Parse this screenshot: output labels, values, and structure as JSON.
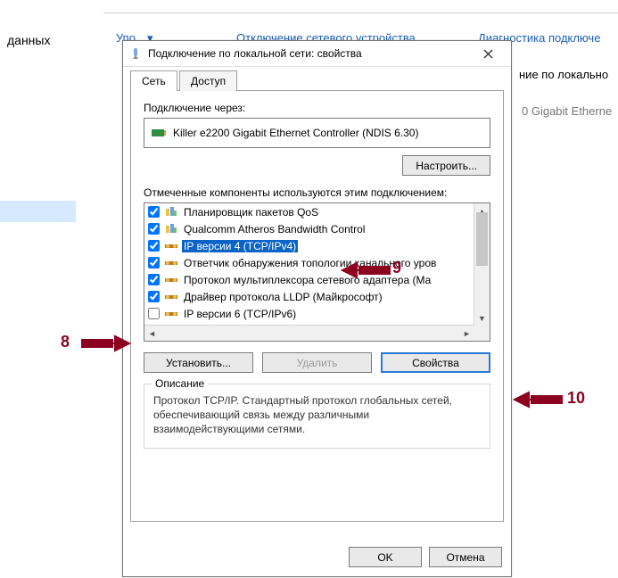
{
  "bg": {
    "left_text": "данных",
    "toolbar_fragment_1": "Упо…▾",
    "toolbar_fragment_2": "Отключение сетевого устройства",
    "toolbar_fragment_3": "Диагностика подключе",
    "side_text_1": "ние по локально",
    "side_text_2": "0 Gigabit Etherne"
  },
  "dialog": {
    "title": "Подключение по локальной сети: свойства",
    "tabs": {
      "net": "Сеть",
      "access": "Доступ"
    },
    "connect_via": "Подключение через:",
    "adapter": "Killer e2200 Gigabit Ethernet Controller (NDIS 6.30)",
    "configure": "Настроить...",
    "components_label": "Отмеченные компоненты используются этим подключением:",
    "items": [
      {
        "checked": true,
        "icon": "qos",
        "label": "Планировщик пакетов QoS"
      },
      {
        "checked": true,
        "icon": "qos",
        "label": "Qualcomm Atheros Bandwidth Control"
      },
      {
        "checked": true,
        "icon": "proto",
        "label": "IP версии 4 (TCP/IPv4)",
        "selected": true
      },
      {
        "checked": true,
        "icon": "proto",
        "label": "Ответчик обнаружения топологии канального уров"
      },
      {
        "checked": true,
        "icon": "proto",
        "label": "Протокол мультиплексора сетевого адаптера (Ма"
      },
      {
        "checked": true,
        "icon": "proto",
        "label": "Драйвер протокола LLDP (Майкрософт)"
      },
      {
        "checked": false,
        "icon": "proto",
        "label": "IP версии 6 (TCP/IPv6)"
      }
    ],
    "install": "Установить...",
    "uninstall": "Удалить",
    "properties": "Свойства",
    "desc_title": "Описание",
    "desc_text": "Протокол TCP/IP. Стандартный протокол глобальных сетей, обеспечивающий связь между различными взаимодействующими сетями.",
    "ok": "OK",
    "cancel": "Отмена"
  },
  "annotations": {
    "a8": "8",
    "a9": "9",
    "a10": "10"
  }
}
